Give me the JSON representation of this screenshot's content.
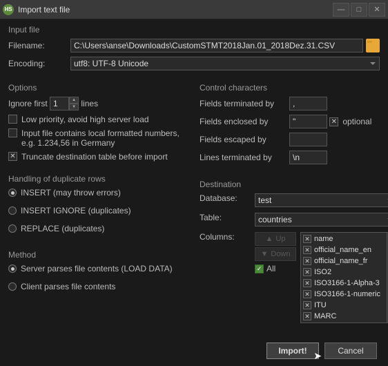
{
  "window": {
    "title": "Import text file"
  },
  "input_file": {
    "section": "Input file",
    "filename_label": "Filename:",
    "filename": "C:\\Users\\anse\\Downloads\\CustomSTMT2018Jan.01_2018Dez.31.CSV",
    "encoding_label": "Encoding:",
    "encoding": "utf8: UTF-8 Unicode"
  },
  "options": {
    "section": "Options",
    "ignore_first_pre": "Ignore first",
    "ignore_first_value": "1",
    "ignore_first_post": "lines",
    "low_priority": "Low priority, avoid high server load",
    "local_numbers": "Input file contains local formatted numbers, e.g. 1.234,56 in Germany",
    "truncate": "Truncate destination table before import"
  },
  "control_chars": {
    "section": "Control characters",
    "terminated_by": "Fields terminated by",
    "terminated_val": ",",
    "enclosed_by": "Fields enclosed by",
    "enclosed_val": "\"",
    "optional": "optional",
    "escaped_by": "Fields escaped by",
    "escaped_val": "",
    "lines_terminated_by": "Lines terminated by",
    "lines_terminated_val": "\\n"
  },
  "duplicates": {
    "section": "Handling of duplicate rows",
    "insert": "INSERT (may throw errors)",
    "insert_ignore": "INSERT IGNORE (duplicates)",
    "replace": "REPLACE (duplicates)"
  },
  "method": {
    "section": "Method",
    "server": "Server parses file contents (LOAD DATA)",
    "client": "Client parses file contents"
  },
  "destination": {
    "section": "Destination",
    "database_label": "Database:",
    "database": "test",
    "table_label": "Table:",
    "table": "countries",
    "columns_label": "Columns:",
    "up": "Up",
    "down": "Down",
    "all": "All",
    "columns": [
      "name",
      "official_name_en",
      "official_name_fr",
      "ISO2",
      "ISO3166-1-Alpha-3",
      "ISO3166-1-numeric",
      "ITU",
      "MARC"
    ]
  },
  "buttons": {
    "import": "Import!",
    "cancel": "Cancel"
  }
}
